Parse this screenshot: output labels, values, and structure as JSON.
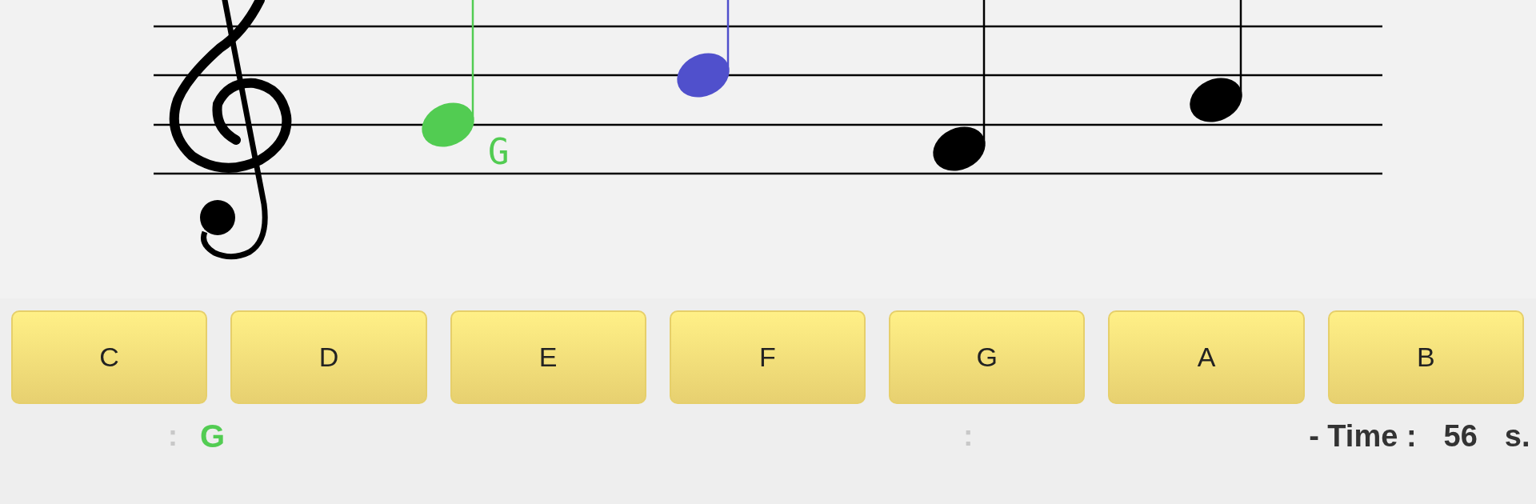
{
  "staff": {
    "notes": [
      {
        "color": "#52cc52",
        "label": "G"
      },
      {
        "color": "#5050cc"
      },
      {
        "color": "#000000"
      },
      {
        "color": "#000000"
      }
    ]
  },
  "answer_buttons": [
    "C",
    "D",
    "E",
    "F",
    "G",
    "A",
    "B"
  ],
  "status": {
    "last_note_separator": ":",
    "last_note": "G",
    "score_separator": ":",
    "time_label": "- Time :",
    "time_value": "56",
    "time_unit": "s."
  }
}
